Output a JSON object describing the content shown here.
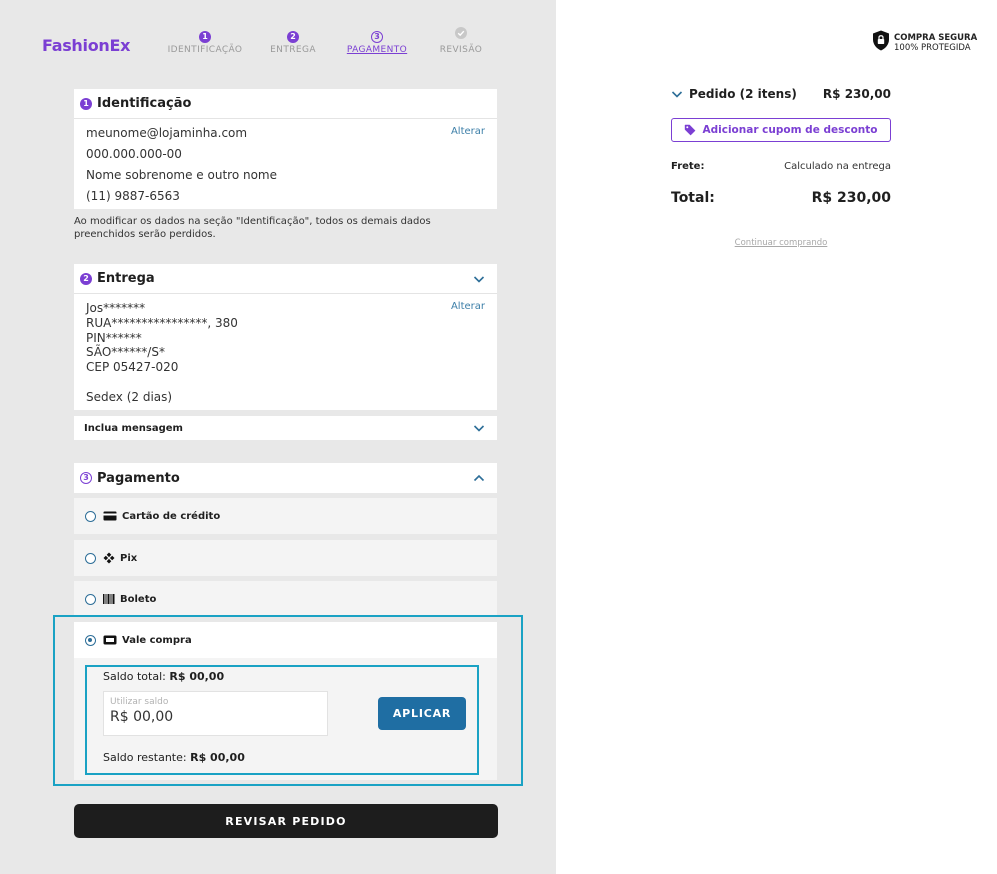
{
  "header": {
    "logo": "FashionEx",
    "steps": [
      {
        "num": "1",
        "label": "IDENTIFICAÇÃO"
      },
      {
        "num": "2",
        "label": "ENTREGA"
      },
      {
        "num": "3",
        "label": "PAGAMENTO"
      },
      {
        "num": "",
        "label": "REVISÃO"
      }
    ]
  },
  "identificacao": {
    "badge": "1",
    "title": "Identificação",
    "alterar": "Alterar",
    "lines": [
      "meunome@lojaminha.com",
      "000.000.000-00",
      "Nome sobrenome e outro nome",
      "(11) 9887-6563"
    ],
    "note": "Ao modificar os dados na seção \"Identificação\", todos os demais dados preenchidos serão perdidos."
  },
  "entrega": {
    "badge": "2",
    "title": "Entrega",
    "alterar": "Alterar",
    "lines": [
      "Jos*******",
      "RUA****************, 380",
      "PIN******",
      "SÃO******/S*",
      "CEP 05427-020"
    ],
    "shipping": "Sedex (2 dias)",
    "message_toggle": "Inclua mensagem"
  },
  "pagamento": {
    "badge": "3",
    "title": "Pagamento",
    "options": [
      {
        "label": "Cartão de crédito",
        "icon": "credit-card-icon",
        "selected": false
      },
      {
        "label": "Pix",
        "icon": "pix-icon",
        "selected": false
      },
      {
        "label": "Boleto",
        "icon": "barcode-icon",
        "selected": false
      },
      {
        "label": "Vale compra",
        "icon": "voucher-icon",
        "selected": true
      }
    ],
    "vale": {
      "saldo_total_label": "Saldo total:",
      "saldo_total_value": "R$ 00,00",
      "input_placeholder": "Utilizar saldo",
      "input_value": "R$ 00,00",
      "apply_label": "APLICAR",
      "saldo_restante_label": "Saldo restante:",
      "saldo_restante_value": "R$ 00,00"
    }
  },
  "review_button": "REVISAR PEDIDO",
  "summary": {
    "secure_line1": "COMPRA SEGURA",
    "secure_line2": "100% PROTEGIDA",
    "order_label": "Pedido (2 itens)",
    "order_value": "R$ 230,00",
    "coupon_label": "Adicionar cupom de desconto",
    "frete_label": "Frete:",
    "frete_value": "Calculado na entrega",
    "total_label": "Total:",
    "total_value": "R$ 230,00",
    "continue_link": "Continuar comprando"
  },
  "colors": {
    "brand": "#7b3fd3",
    "primary_button": "#1f6ea3",
    "highlight": "#1aa2c4"
  }
}
